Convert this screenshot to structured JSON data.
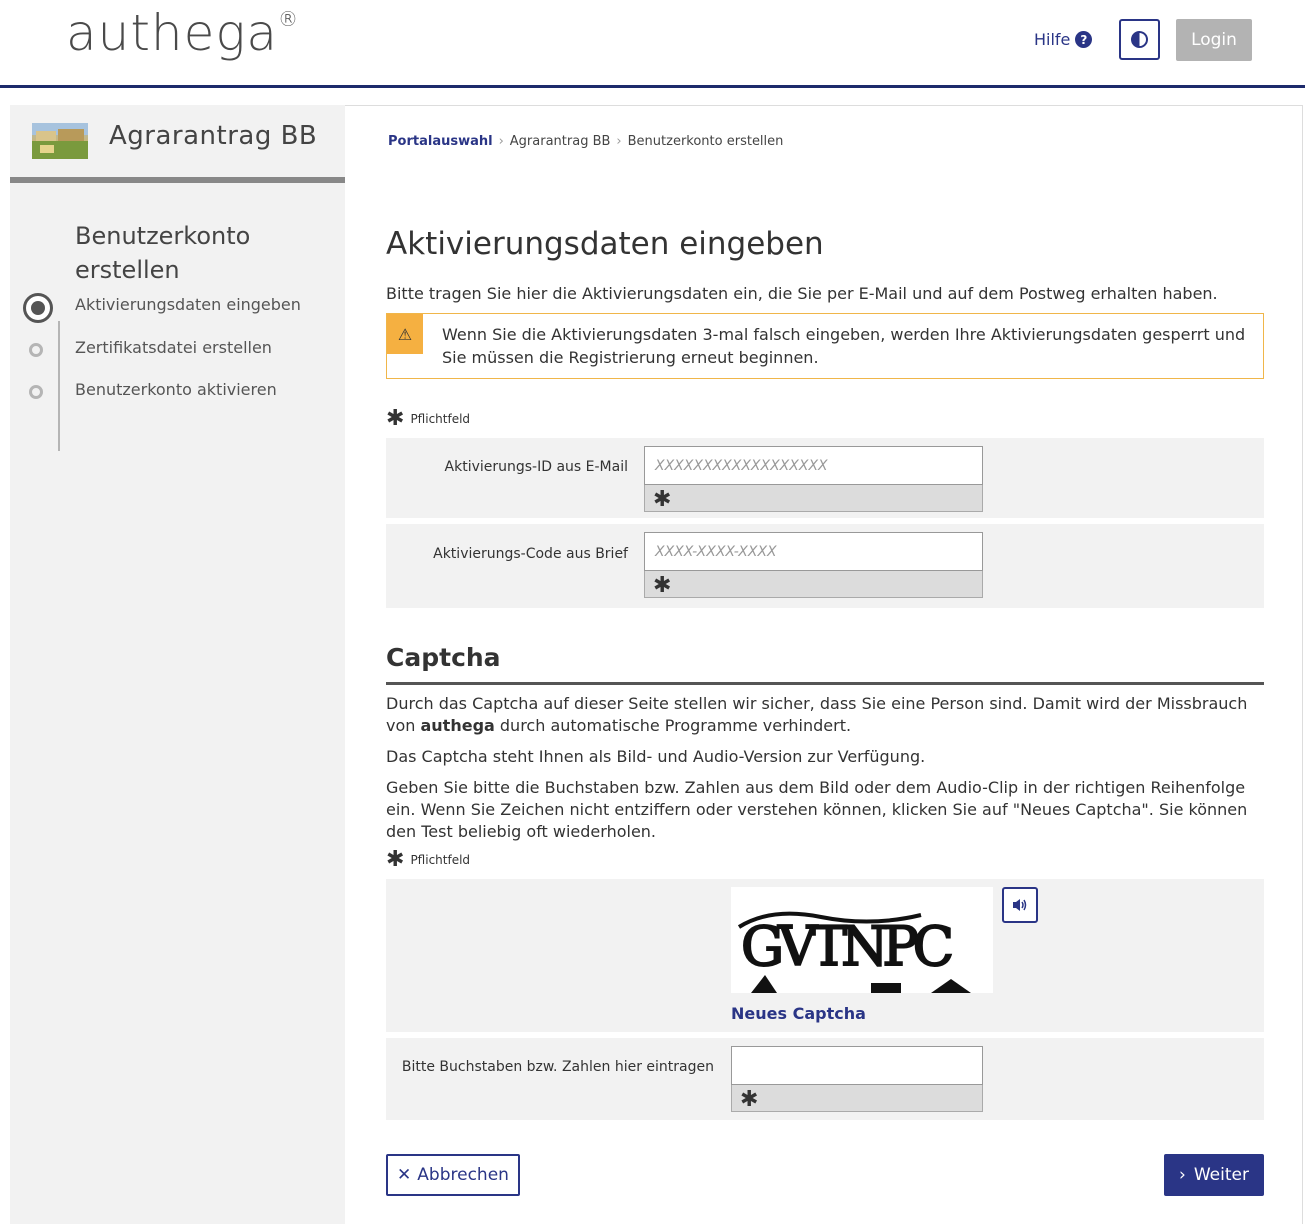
{
  "header": {
    "logo_text": "authega",
    "logo_reg": "®",
    "help_label": "Hilfe",
    "help_icon": "question-circle-icon",
    "contrast_icon": "contrast-icon",
    "login_label": "Login"
  },
  "sidebar": {
    "portal_title": "Agrarantrag  BB",
    "heading": "Benutzerkonto erstellen",
    "steps": [
      {
        "label": "Aktivierungsdaten eingeben",
        "active": true
      },
      {
        "label": "Zertifikatsdatei erstellen",
        "active": false
      },
      {
        "label": "Benutzerkonto aktivieren",
        "active": false
      }
    ]
  },
  "breadcrumb": {
    "items": [
      "Portalauswahl",
      "Agrarantrag BB",
      "Benutzerkonto erstellen"
    ],
    "separator": "›"
  },
  "main": {
    "title": "Aktivierungsdaten eingeben",
    "intro": "Bitte tragen Sie hier die Aktivierungsdaten ein, die Sie per E-Mail und auf dem Postweg erhalten haben.",
    "warning_icon": "⚠",
    "warning": "Wenn Sie die Aktivierungsdaten 3-mal falsch eingeben, werden Ihre Aktivierungsdaten gesperrt und Sie müssen die Registrierung erneut beginnen.",
    "required_note": "Pflichtfeld",
    "required_star": "✱",
    "fields": [
      {
        "label": "Aktivierungs-ID aus E-Mail",
        "placeholder": "XXXXXXXXXXXXXXXXXX",
        "value": ""
      },
      {
        "label": "Aktivierungs-Code aus Brief",
        "placeholder": "XXXX-XXXX-XXXX",
        "value": ""
      }
    ]
  },
  "captcha": {
    "title": "Captcha",
    "p1_before": "Durch das Captcha auf dieser Seite stellen wir sicher, dass Sie eine Person sind. Damit wird der Missbrauch von ",
    "p1_bold": "authega",
    "p1_after": " durch automatische Programme verhindert.",
    "p2": "Das Captcha steht Ihnen als Bild- und Audio-Version zur Verfügung.",
    "p3": "Geben Sie bitte die Buchstaben bzw. Zahlen aus dem Bild oder dem Audio-Clip in der richtigen Reihenfolge ein. Wenn Sie Zeichen nicht entziffern oder verstehen können, klicken Sie auf \"Neues Captcha\". Sie können den Test beliebig oft wiederholen.",
    "required_note": "Pflichtfeld",
    "image_text": "GVTNPC",
    "audio_icon": "speaker-icon",
    "new_captcha_label": "Neues Captcha",
    "input_label": "Bitte Buchstaben bzw. Zahlen hier eintragen",
    "input_value": ""
  },
  "actions": {
    "cancel_label": "Abbrechen",
    "cancel_icon": "close-icon",
    "next_label": "Weiter",
    "next_icon": "chevron-right-icon"
  },
  "colors": {
    "brand": "#2a3586",
    "warning": "#f5b041",
    "panel": "#f2f2f2"
  }
}
